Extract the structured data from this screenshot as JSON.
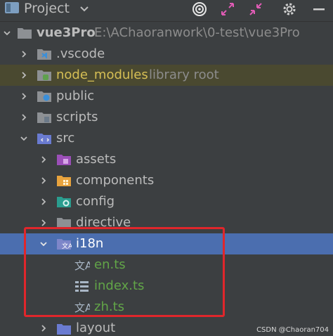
{
  "toolbar": {
    "title": "Project"
  },
  "tree": {
    "root": {
      "label": "vue3Pro",
      "path": "E:\\AChaoranwork\\0-test\\vue3Pro"
    },
    "vscode": ".vscode",
    "node_modules": {
      "label": "node_modules",
      "hint": "library root"
    },
    "public": "public",
    "scripts": "scripts",
    "src": "src",
    "assets": "assets",
    "components": "components",
    "config": "config",
    "directive": "directive",
    "i18n": "i18n",
    "en": "en.ts",
    "index": "index.ts",
    "zh": "zh.ts",
    "layout": "layout"
  },
  "watermark": "CSDN @Chaoran704",
  "colors": {
    "background": "#3c3f41",
    "selection": "#4b6eaf",
    "highlight_box": "#e0262b",
    "file_text": "#62a548"
  }
}
